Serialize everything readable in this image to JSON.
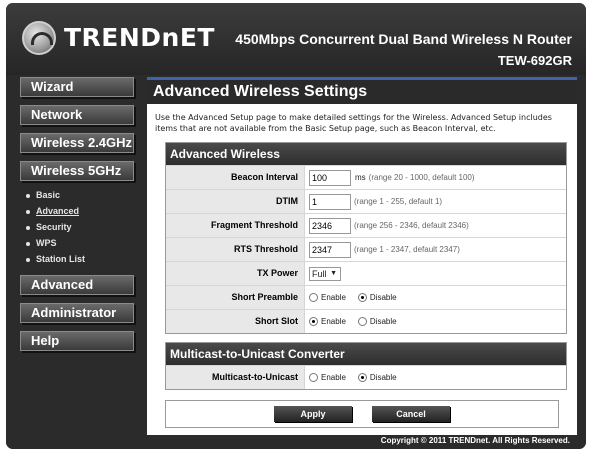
{
  "header": {
    "brand": "TRENDnET",
    "product": "450Mbps Concurrent Dual Band Wireless N Router",
    "model": "TEW-692GR"
  },
  "sidebar": {
    "items": [
      {
        "label": "Wizard"
      },
      {
        "label": "Network"
      },
      {
        "label": "Wireless 2.4GHz"
      },
      {
        "label": "Wireless 5GHz"
      },
      {
        "label": "Advanced"
      },
      {
        "label": "Administrator"
      },
      {
        "label": "Help"
      }
    ],
    "sub_items": [
      {
        "label": "Basic"
      },
      {
        "label": "Advanced"
      },
      {
        "label": "Security"
      },
      {
        "label": "WPS"
      },
      {
        "label": "Station List"
      }
    ]
  },
  "page": {
    "title": "Advanced Wireless Settings",
    "description": "Use the Advanced Setup page to make detailed settings for the Wireless. Advanced Setup includes items that are not available from the Basic Setup page, such as Beacon Interval, etc."
  },
  "advanced_section": {
    "title": "Advanced Wireless",
    "beacon_interval": {
      "label": "Beacon Interval",
      "value": "100",
      "unit": "ms",
      "hint": "(range 20 - 1000, default 100)"
    },
    "dtim": {
      "label": "DTIM",
      "value": "1",
      "hint": "(range 1 - 255, default 1)"
    },
    "fragment_threshold": {
      "label": "Fragment Threshold",
      "value": "2346",
      "hint": "(range 256 - 2346, default 2346)"
    },
    "rts_threshold": {
      "label": "RTS Threshold",
      "value": "2347",
      "hint": "(range 1 - 2347, default 2347)"
    },
    "tx_power": {
      "label": "TX Power",
      "value": "Full"
    },
    "short_preamble": {
      "label": "Short Preamble",
      "enable": "Enable",
      "disable": "Disable",
      "selected": "Disable"
    },
    "short_slot": {
      "label": "Short Slot",
      "enable": "Enable",
      "disable": "Disable",
      "selected": "Enable"
    }
  },
  "multicast_section": {
    "title": "Multicast-to-Unicast Converter",
    "multicast": {
      "label": "Multicast-to-Unicast",
      "enable": "Enable",
      "disable": "Disable",
      "selected": "Disable"
    }
  },
  "actions": {
    "apply": "Apply",
    "cancel": "Cancel"
  },
  "footer": {
    "copyright": "Copyright © 2011 TRENDnet. All Rights Reserved."
  }
}
